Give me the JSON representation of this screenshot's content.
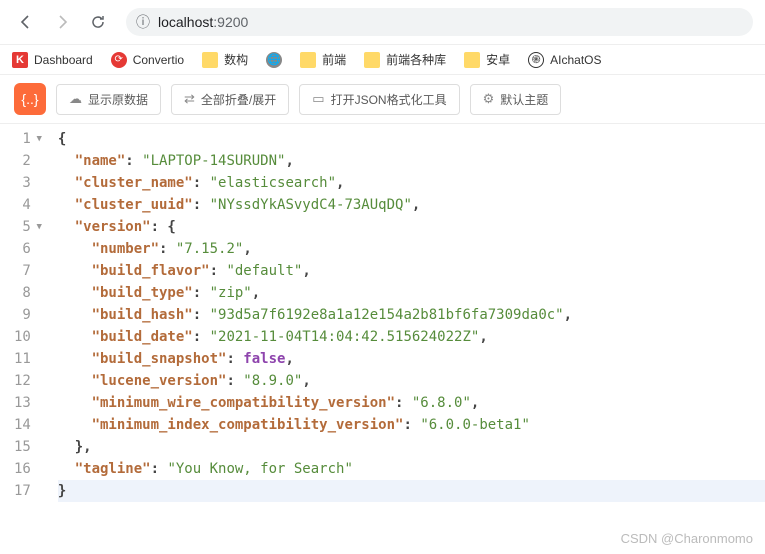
{
  "nav": {
    "host": "localhost",
    "port": ":9200"
  },
  "bookmarks": [
    {
      "label": "Dashboard",
      "icon": "k"
    },
    {
      "label": "Convertio",
      "icon": "conv"
    },
    {
      "label": "数构",
      "icon": "folder"
    },
    {
      "label": "",
      "icon": "globe"
    },
    {
      "label": "前端",
      "icon": "folder"
    },
    {
      "label": "前端各种库",
      "icon": "folder"
    },
    {
      "label": "安卓",
      "icon": "folder"
    },
    {
      "label": "AIchatOS",
      "icon": "ai"
    }
  ],
  "toolbar": {
    "raw": "显示原数据",
    "fold": "全部折叠/展开",
    "jsontool": "打开JSON格式化工具",
    "theme": "默认主题"
  },
  "json": {
    "name": "LAPTOP-14SURUDN",
    "cluster_name": "elasticsearch",
    "cluster_uuid": "NYssdYkASvydC4-73AUqDQ",
    "version": {
      "number": "7.15.2",
      "build_flavor": "default",
      "build_type": "zip",
      "build_hash": "93d5a7f6192e8a1a12e154a2b81bf6fa7309da0c",
      "build_date": "2021-11-04T14:04:42.515624022Z",
      "build_snapshot": "false",
      "lucene_version": "8.9.0",
      "minimum_wire_compatibility_version": "6.8.0",
      "minimum_index_compatibility_version": "6.0.0-beta1"
    },
    "tagline": "You Know, for Search"
  },
  "keys": {
    "name": "\"name\"",
    "cluster_name": "\"cluster_name\"",
    "cluster_uuid": "\"cluster_uuid\"",
    "version": "\"version\"",
    "number": "\"number\"",
    "build_flavor": "\"build_flavor\"",
    "build_type": "\"build_type\"",
    "build_hash": "\"build_hash\"",
    "build_date": "\"build_date\"",
    "build_snapshot": "\"build_snapshot\"",
    "lucene_version": "\"lucene_version\"",
    "min_wire": "\"minimum_wire_compatibility_version\"",
    "min_index": "\"minimum_index_compatibility_version\"",
    "tagline": "\"tagline\""
  },
  "vals": {
    "name": "\"LAPTOP-14SURUDN\"",
    "cluster_name": "\"elasticsearch\"",
    "cluster_uuid": "\"NYssdYkASvydC4-73AUqDQ\"",
    "number": "\"7.15.2\"",
    "build_flavor": "\"default\"",
    "build_type": "\"zip\"",
    "build_hash": "\"93d5a7f6192e8a1a12e154a2b81bf6fa7309da0c\"",
    "build_date": "\"2021-11-04T14:04:42.515624022Z\"",
    "lucene_version": "\"8.9.0\"",
    "min_wire": "\"6.8.0\"",
    "min_index": "\"6.0.0-beta1\"",
    "tagline": "\"You Know, for Search\""
  },
  "watermark": "CSDN @Charonmomo"
}
